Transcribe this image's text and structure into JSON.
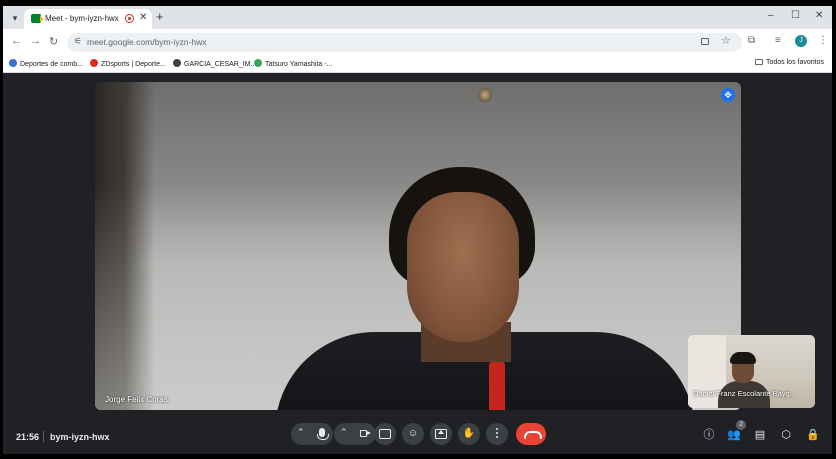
{
  "browser": {
    "tab_title": "Meet - bym-iyzn-hwx",
    "tab_close": "✕",
    "new_tab": "+",
    "url": "meet.google.com/bym-iyzn-hwx",
    "profile_initial": "J",
    "window_controls": {
      "minimize": "–",
      "maximize": "☐",
      "close": "✕"
    }
  },
  "bookmarks": [
    {
      "label": "Deportes de comb...",
      "color": "#3b6fd6"
    },
    {
      "label": "ZDsports | Deporte...",
      "color": "#d93025"
    },
    {
      "label": "GARCIA_CESAR_IM...",
      "color": "#3c4043"
    },
    {
      "label": "Tatsuro Yamashita -...",
      "color": "#34a853"
    }
  ],
  "bookmarks_all": "Todos los favoritos",
  "meet": {
    "main_participant": "Jorge Felix Coras",
    "self_participant": "Daniel Franz Escolante Bayg...",
    "time": "21:56",
    "meeting_code": "bym-iyzn-hwx",
    "participant_count": "2",
    "accent_red": "#ea4335",
    "accent_blue": "#1a73e8"
  }
}
